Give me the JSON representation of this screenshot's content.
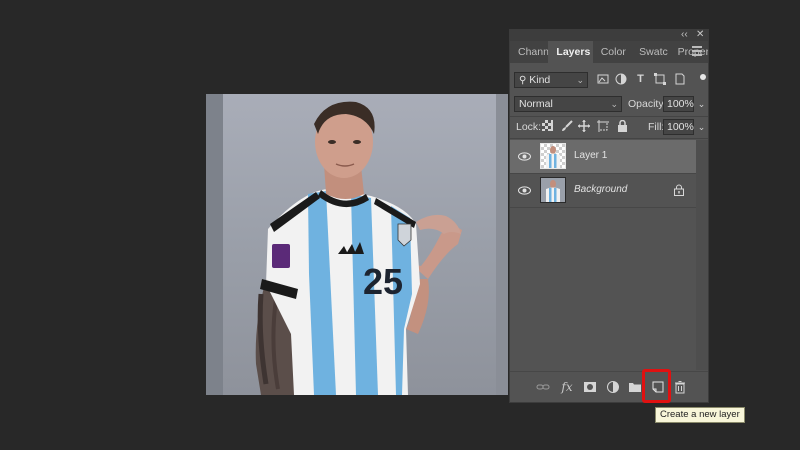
{
  "panel": {
    "tabs": [
      {
        "label": "Chann",
        "active": false
      },
      {
        "label": "Layers",
        "active": true
      },
      {
        "label": "Color",
        "active": false
      },
      {
        "label": "Swatc",
        "active": false
      },
      {
        "label": "Proper",
        "active": false
      }
    ],
    "filter": {
      "kind_label": "Kind"
    },
    "blend_mode": "Normal",
    "opacity_label": "Opacity:",
    "opacity_value": "100%",
    "lock_label": "Lock:",
    "fill_label": "Fill:",
    "fill_value": "100%",
    "layers": [
      {
        "name": "Layer 1",
        "visible": true,
        "selected": true,
        "transparent": true
      },
      {
        "name": "Background",
        "visible": true,
        "selected": false,
        "locked": true
      }
    ]
  },
  "bottom_bar": {
    "icons": [
      "link-icon",
      "fx-icon",
      "mask-icon",
      "adjustment-icon",
      "folder-icon",
      "new-layer-icon",
      "trash-icon"
    ],
    "fx_label": "fx"
  },
  "tooltip": {
    "text": "Create a new layer"
  },
  "jersey": {
    "number": "25"
  },
  "colors": {
    "highlight": "#e01111",
    "jersey_blue": "#6fb2e0"
  }
}
